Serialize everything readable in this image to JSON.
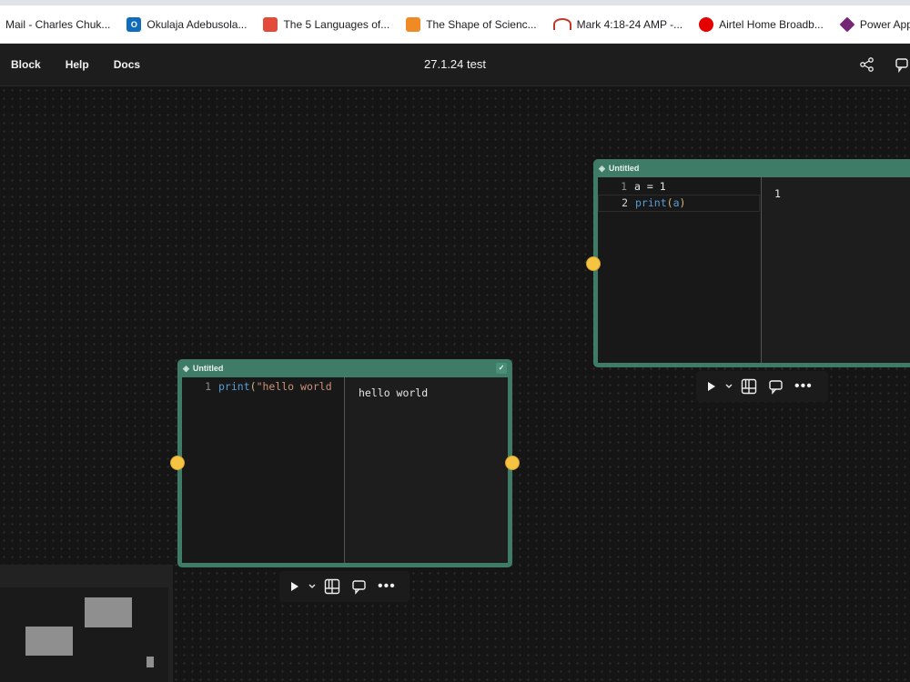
{
  "bookmarks": [
    {
      "label": "Mail - Charles Chuk...",
      "icon": "mail-icon",
      "color": "#0078d4"
    },
    {
      "label": "Okulaja Adebusola...",
      "icon": "outlook-icon",
      "color": "#0f6cbd"
    },
    {
      "label": "The 5 Languages of...",
      "icon": "site-icon",
      "color": "#e44a3a"
    },
    {
      "label": "The Shape of Scienc...",
      "icon": "lightbulb-icon",
      "color": "#f08a24"
    },
    {
      "label": "Mark 4:18-24 AMP -...",
      "icon": "bible-icon",
      "color": "#c0392b"
    },
    {
      "label": "Airtel Home Broadb...",
      "icon": "airtel-icon",
      "color": "#e40000"
    },
    {
      "label": "Power Apps",
      "icon": "powerapps-icon",
      "color": "#742774"
    }
  ],
  "app": {
    "menu": [
      "Block",
      "Help",
      "Docs"
    ],
    "title": "27.1.24 test",
    "icons": [
      "share-icon",
      "comments-icon"
    ]
  },
  "blocks": {
    "right": {
      "title": "Untitled",
      "code": [
        {
          "num": "1",
          "text": "a = 1"
        },
        {
          "num": "2",
          "fn": "print",
          "open": "(",
          "arg": "a",
          "close": ")"
        }
      ],
      "output": "1"
    },
    "left": {
      "title": "Untitled",
      "code": [
        {
          "num": "1",
          "fn": "print",
          "open": "(",
          "str": "\"hello world"
        }
      ],
      "output": "hello world"
    }
  },
  "toolbar": {
    "run_icon": "play-icon",
    "dropdown_icon": "chevron-down-icon",
    "layout_icon": "layout-icon",
    "comment_icon": "comment-icon",
    "more_icon": "more-icon"
  },
  "colors": {
    "block_border": "#3e7c67",
    "handle": "#f6c342",
    "canvas": "#151515"
  }
}
